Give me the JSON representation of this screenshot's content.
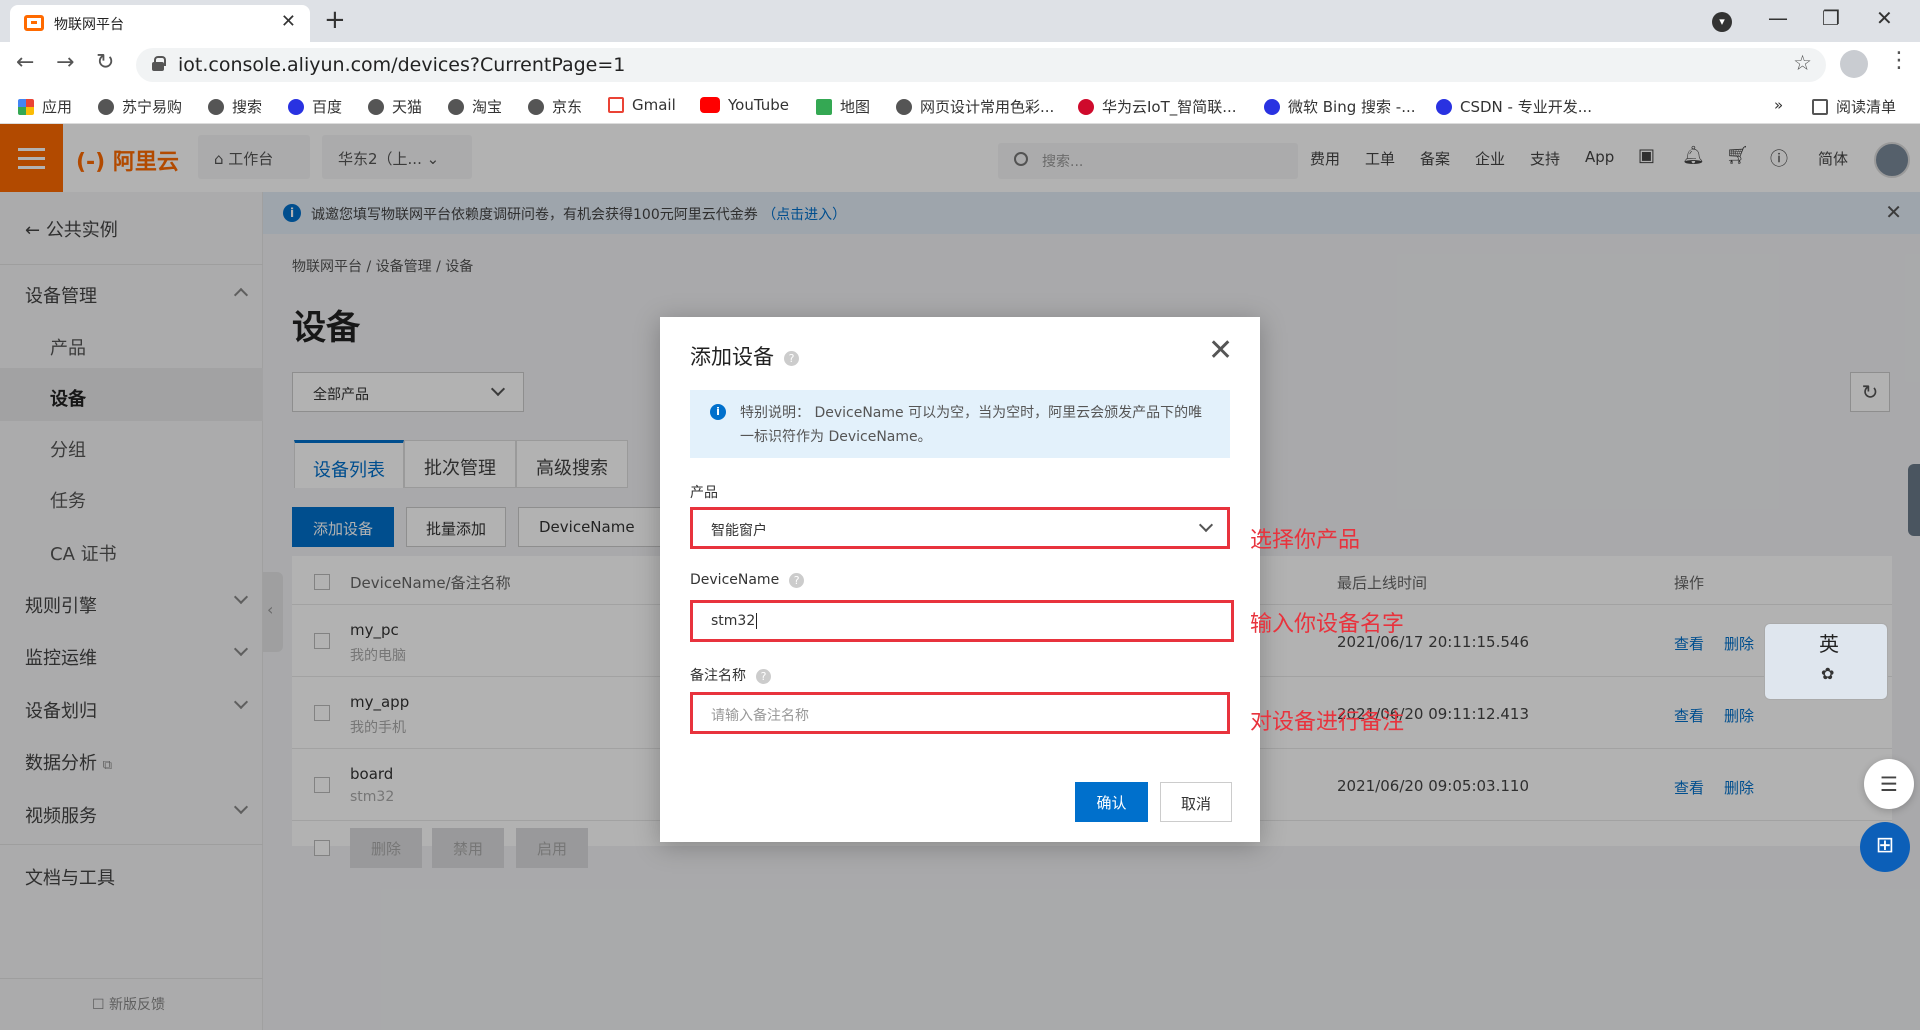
{
  "browser": {
    "tab_title": "物联网平台",
    "url": "iot.console.aliyun.com/devices?CurrentPage=1",
    "bookmarks": [
      "应用",
      "苏宁易购",
      "搜索",
      "百度",
      "天猫",
      "淘宝",
      "京东",
      "Gmail",
      "YouTube",
      "地图",
      "网页设计常用色彩...",
      "华为云IoT_智简联...",
      "微软 Bing 搜索 -...",
      "CSDN - 专业开发..."
    ],
    "bookmarks_more": "»",
    "reading_list": "阅读清单"
  },
  "topnav": {
    "logo": "阿里云",
    "workbench": "工作台",
    "region": "华东2（上...",
    "search_placeholder": "搜索...",
    "links": [
      "费用",
      "工单",
      "备案",
      "企业",
      "支持",
      "App"
    ],
    "lang": "简体"
  },
  "sidebar": {
    "back_label": "公共实例",
    "section_device_mgmt": "设备管理",
    "sub_items": [
      "产品",
      "设备",
      "分组",
      "任务",
      "CA 证书"
    ],
    "sections": [
      "规则引擎",
      "监控运维",
      "设备划归",
      "数据分析",
      "视频服务"
    ],
    "docs": "文档与工具",
    "feedback": "新版反馈"
  },
  "notice": {
    "text": "诚邀您填写物联网平台依赖度调研问卷，有机会获得100元阿里云代金券",
    "link": "（点击进入）"
  },
  "main": {
    "breadcrumb": "物联网平台  /  设备管理  /  设备",
    "title": "设备",
    "product_filter": "全部产品",
    "tabs": [
      "设备列表",
      "批次管理",
      "高级搜索"
    ],
    "add_button": "添加设备",
    "batch_button": "批量添加",
    "search_field": "DeviceName",
    "columns": {
      "name": "DeviceName/备注名称",
      "last_online": "最后上线时间",
      "ops": "操作"
    },
    "rows": [
      {
        "name": "my_pc",
        "nick": "我的电脑",
        "time": "2021/06/17 20:11:15.546"
      },
      {
        "name": "my_app",
        "nick": "我的手机",
        "time": "2021/06/20 09:11:12.413"
      },
      {
        "name": "board",
        "nick": "stm32",
        "time": "2021/06/20 09:05:03.110"
      }
    ],
    "op_view": "查看",
    "op_delete": "删除",
    "bulk": [
      "删除",
      "禁用",
      "启用"
    ]
  },
  "modal": {
    "title": "添加设备",
    "info": "特别说明：  DeviceName 可以为空，当为空时，阿里云会颁发产品下的唯一标识符作为 DeviceName。",
    "product_label": "产品",
    "product_value": "智能窗户",
    "devicename_label": "DeviceName",
    "devicename_value": "stm32",
    "remark_label": "备注名称",
    "remark_placeholder": "请输入备注名称",
    "confirm": "确认",
    "cancel": "取消"
  },
  "annotations": {
    "product": "选择你产品",
    "devicename": "输入你设备名字",
    "remark": "对设备进行备注"
  },
  "ime_char": "英",
  "colors": {
    "brand": "#ff6a00",
    "primary": "#0070cc",
    "annotation_red": "#e8333d"
  }
}
